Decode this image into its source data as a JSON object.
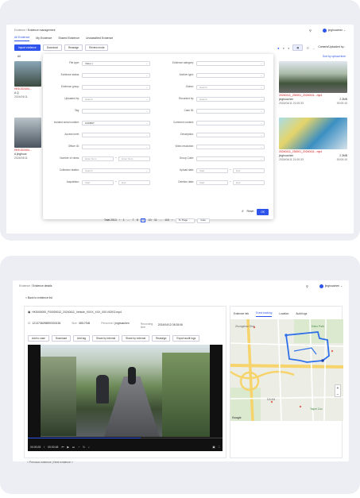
{
  "list_page": {
    "breadcrumb": [
      "Evidence",
      "Evidence management"
    ],
    "user": "jinghuachen",
    "tabs": [
      "All Evidence",
      "My Evidence",
      "Shared Evidence",
      "Unclassified Evidence"
    ],
    "toolbar": {
      "import": "Import evidence",
      "download": "Download",
      "reassign": "Reassign",
      "review": "Review mode",
      "sort": "Camera/Uploaded by..."
    },
    "filter_all": "All",
    "sort_hint": "Sort by upload time",
    "cards": [
      {
        "title": "20240411_230001_20240411...mp4",
        "owner": "jinghuachen",
        "size": "2.3MB",
        "date": "2024/04/11 21:00:33",
        "duration": "00:00:10"
      },
      {
        "title": "20240411_230001_20240411...mp4",
        "owner": "jinghuachen",
        "size": "2.3MB",
        "date": "2024/04/11 21:00:33",
        "duration": "00:00:10"
      },
      {
        "title": "20240411_230001_20240411...mp4",
        "owner": "jinghuachen",
        "size": "2.3MB",
        "date": "2024/04/11 21:00:33",
        "duration": "00:00:10"
      },
      {
        "title": "20240411_230001_20240411...mp4",
        "owner": "jinghuachen",
        "size": "2.3MB",
        "date": "2024/04/11 21:00:33",
        "duration": "00:00:10"
      }
    ],
    "left_peek": [
      {
        "title": "HK5 202404...",
        "owner": "A Q",
        "date": "2024/04/11"
      },
      {
        "title": "HK5 202404...",
        "owner": "A jinghuac",
        "date": "2024/04/11"
      }
    ],
    "filter_form": {
      "left": [
        {
          "label": "File type:",
          "value": "Video ×"
        },
        {
          "label": "Evidence status:",
          "value": ""
        },
        {
          "label": "Evidence group:",
          "value": ""
        },
        {
          "label": "Uploaded by:",
          "value": "Search"
        },
        {
          "label": "Tag:",
          "value": ""
        },
        {
          "label": "Incident serial number:",
          "value": "1234567"
        },
        {
          "label": "Access level:",
          "value": ""
        },
        {
          "label": "Officer ID:",
          "value": ""
        },
        {
          "label": "Number of views:",
          "value": "Enter Num"
        },
        {
          "label": "Collection station:",
          "value": "Search"
        },
        {
          "label": "Acquisition:",
          "value": "Start"
        }
      ],
      "right": [
        {
          "label": "Evidence category:",
          "value": ""
        },
        {
          "label": "Archive type:",
          "value": ""
        },
        {
          "label": "Owner:",
          "value": "Search"
        },
        {
          "label": "Recorded by:",
          "value": "Search"
        },
        {
          "label": "Case ID:",
          "value": ""
        },
        {
          "label": "Comment content:",
          "value": ""
        },
        {
          "label": "Description:",
          "value": ""
        },
        {
          "label": "Video resolution:",
          "value": ""
        },
        {
          "label": "Group Code:",
          "value": ""
        },
        {
          "label": "Upload date:",
          "value": "Start"
        },
        {
          "label": "Deletion date:",
          "value": "Start"
        }
      ],
      "views_max": "Enter Num",
      "end_label": "End",
      "reset": "Reset",
      "ok": "OK"
    },
    "pagination": {
      "total": "Total 2013",
      "pages": [
        "1",
        "...",
        "7",
        "8",
        "9",
        "10",
        "11",
        "...",
        "110"
      ],
      "active": "9",
      "per_page": "8 / Page",
      "goto": "Goto"
    }
  },
  "detail_page": {
    "breadcrumb": [
      "Evidence",
      "Evidence details"
    ],
    "user": "jinghuachen",
    "back": "< Back to evidence list",
    "file_name": "HK5000000_F00000012_20240411_Vehicle_XXXX_XXX_000.VIDEO.mp4",
    "meta": [
      {
        "label": "ID",
        "value": "1213736298890330136"
      },
      {
        "label": "Size",
        "value": "455.07kB"
      },
      {
        "label": "Personnel",
        "value": "jinghuachen"
      },
      {
        "label": "Recording time",
        "value": "2024/04/12 08:28:06"
      }
    ],
    "actions": [
      "Add to case",
      "Download",
      "Add tag",
      "Share by internal",
      "Share by external",
      "Reassign",
      "Export audit logs"
    ],
    "player": {
      "current": "00:00:28",
      "total": "00:00:48"
    },
    "prev_next": "< Previous evidence  |  Next evidence >",
    "side_tabs": [
      "Evidence info",
      "Event tracking",
      "Location",
      "Audit logs"
    ],
    "side_active": "Event tracking",
    "map_labels": [
      "Google",
      "Zhongshan Dist.",
      "DA'AN",
      "Dahu Park",
      "Taipei Zoo"
    ]
  }
}
